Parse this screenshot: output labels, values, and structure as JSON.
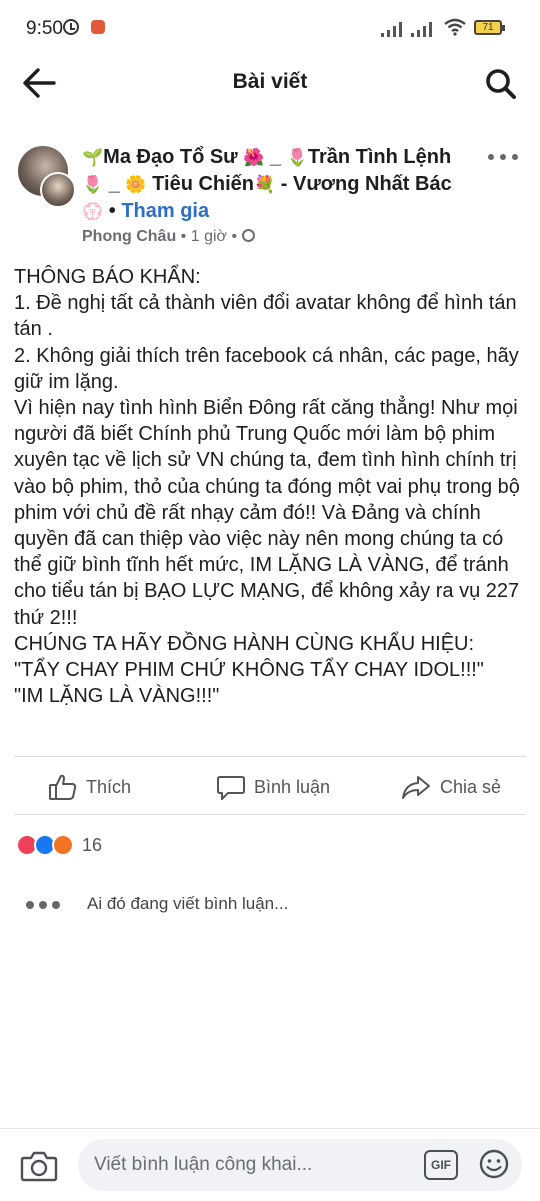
{
  "status_bar": {
    "time": "9:50",
    "battery": "71"
  },
  "app_bar": {
    "title": "Bài viết"
  },
  "post": {
    "group_name_parts": [
      "Ma Đạo Tổ Sư",
      "_",
      "Trần Tình Lệnh",
      "_",
      "Tiêu Chiến",
      "- Vương Nhất Bác"
    ],
    "join_label": "Tham gia",
    "separator": "•",
    "author": "Phong Châu",
    "time_ago": "1 giờ",
    "body": "THÔNG BÁO KHẨN:\n1. Đề nghị tất cả thành viên đổi avatar không để hình tán tán .\n2. Không giải thích trên facebook cá nhân, các page, hãy giữ im lặng.\nVì hiện nay tình hình Biển Đông rất căng thẳng! Như mọi người đã biết Chính phủ Trung Quốc mới làm bộ phim xuyên tạc về lịch sử VN chúng ta, đem tình hình chính trị vào bộ phim, thỏ của chúng ta đóng một vai phụ trong bộ phim với chủ đề rất nhạy cảm đó!! Và Đảng và chính quyền đã can thiệp vào việc này nên mong chúng ta có thể giữ bình tĩnh hết mức, IM LẶNG LÀ VÀNG, để tránh cho tiểu tán  bị BẠO LỰC MẠNG, để không xảy ra vụ 227 thứ 2!!!\nCHÚNG TA HÃY ĐỒNG HÀNH CÙNG KHẨU HIỆU:\n\"TẨY CHAY PHIM CHỨ KHÔNG TẨY CHAY IDOL!!!\"\n\"IM LẶNG LÀ VÀNG!!!\""
  },
  "actions": {
    "like": "Thích",
    "comment": "Bình luận",
    "share": "Chia sẻ"
  },
  "reactions": {
    "count": "16",
    "types": [
      "love-icon",
      "like-icon",
      "angry-icon"
    ]
  },
  "typing_indicator": "Ai đó đang viết bình luận...",
  "comment_bar": {
    "placeholder": "Viết bình luận công khai...",
    "gif_label": "GIF"
  },
  "colors": {
    "link": "#2d6fc7",
    "text": "#1c1e21",
    "secondary": "#6a6d71",
    "love": "#f0415a",
    "like": "#1877f2",
    "angry": "#f27323"
  }
}
